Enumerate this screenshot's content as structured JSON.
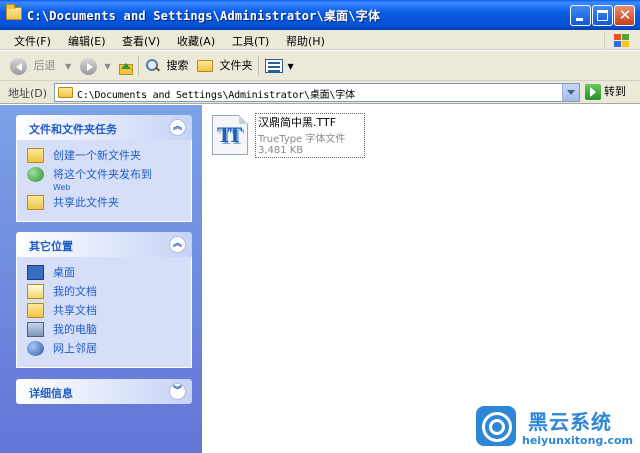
{
  "window": {
    "title": "C:\\Documents and Settings\\Administrator\\桌面\\字体",
    "controls": [
      "minimize-icon",
      "maximize-icon",
      "close-icon"
    ]
  },
  "menu": [
    "文件(F)",
    "编辑(E)",
    "查看(V)",
    "收藏(A)",
    "工具(T)",
    "帮助(H)"
  ],
  "toolbar": {
    "back_label": "后退",
    "search_label": "搜索",
    "folders_label": "文件夹"
  },
  "address": {
    "label": "地址(D)",
    "value": "C:\\Documents and Settings\\Administrator\\桌面\\字体",
    "go_label": "转到"
  },
  "tasks_panel": {
    "title": "文件和文件夹任务",
    "items": [
      {
        "label": "创建一个新文件夹",
        "icon": "new-folder-icon"
      },
      {
        "label": "将这个文件夹发布到",
        "sub": "Web",
        "icon": "publish-web-icon"
      },
      {
        "label": "共享此文件夹",
        "icon": "share-folder-icon"
      }
    ]
  },
  "places_panel": {
    "title": "其它位置",
    "items": [
      {
        "label": "桌面",
        "icon": "desktop-icon"
      },
      {
        "label": "我的文档",
        "icon": "my-documents-icon"
      },
      {
        "label": "共享文档",
        "icon": "shared-documents-icon"
      },
      {
        "label": "我的电脑",
        "icon": "my-computer-icon"
      },
      {
        "label": "网上邻居",
        "icon": "network-places-icon"
      }
    ]
  },
  "details_panel": {
    "title": "详细信息"
  },
  "file": {
    "name": "汉鼎简中黑.TTF",
    "type": "TrueType 字体文件",
    "size": "3,481 KB",
    "icon": "truetype-font-icon",
    "glyph": "TT"
  },
  "watermark": {
    "title": "黑云系统",
    "url": "heiyunxitong.com"
  },
  "colors": {
    "titlebar": "#0a5de6",
    "taskpane": "#7ba2e7",
    "panel_title": "#215dc6",
    "chrome": "#ece9d8"
  }
}
